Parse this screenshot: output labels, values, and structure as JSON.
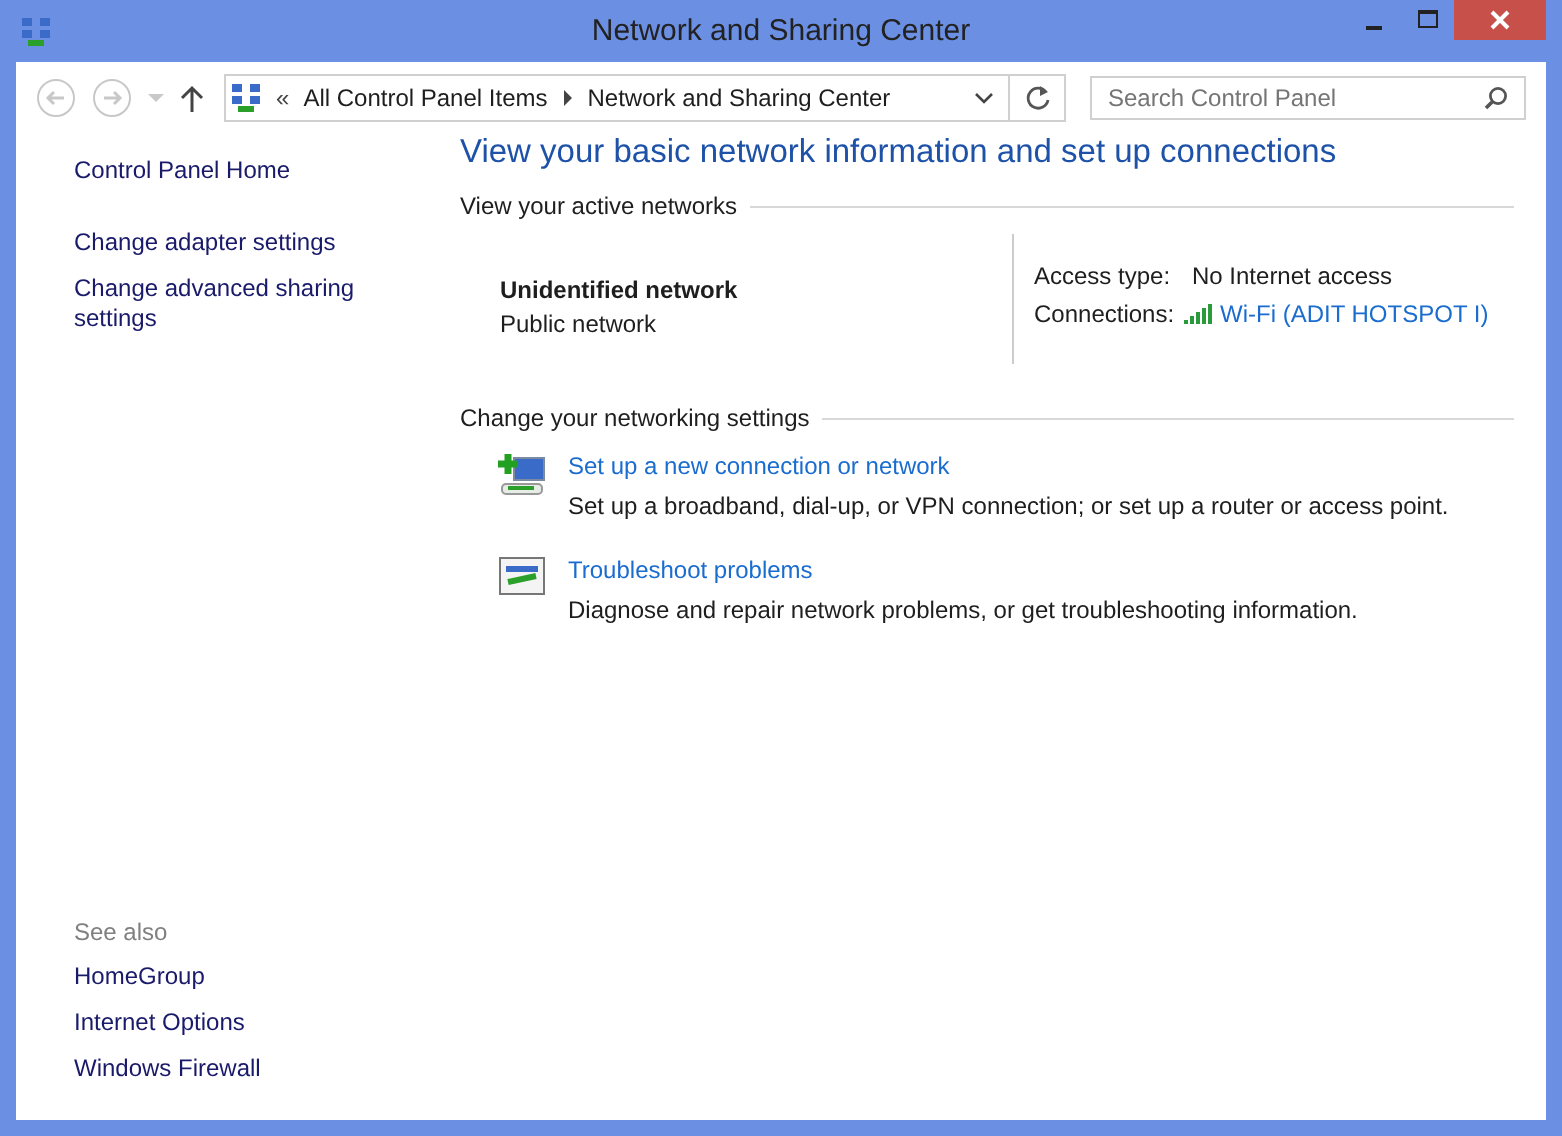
{
  "window": {
    "title": "Network and Sharing Center"
  },
  "address_bar": {
    "overflow": "«",
    "breadcrumbs": [
      "All Control Panel Items",
      "Network and Sharing Center"
    ]
  },
  "search": {
    "placeholder": "Search Control Panel"
  },
  "sidebar": {
    "items": [
      "Control Panel Home",
      "Change adapter settings",
      "Change advanced sharing settings"
    ],
    "see_also": {
      "heading": "See also",
      "items": [
        "HomeGroup",
        "Internet Options",
        "Windows Firewall"
      ]
    }
  },
  "main": {
    "heading": "View your basic network information and set up connections",
    "active_networks": {
      "heading": "View your active networks",
      "network_name": "Unidentified network",
      "network_type": "Public network",
      "access_type_label": "Access type:",
      "access_type": "No Internet access",
      "connections_label": "Connections:",
      "connection": "Wi-Fi (ADIT HOTSPOT I)"
    },
    "settings": {
      "heading": "Change your networking settings",
      "tasks": [
        {
          "kind": "new-connection",
          "link": "Set up a new connection or network",
          "description": "Set up a broadband, dial-up, or VPN connection; or set up a router or access point."
        },
        {
          "kind": "troubleshoot",
          "link": "Troubleshoot problems",
          "description": "Diagnose and repair network problems, or get troubleshooting information."
        }
      ]
    }
  }
}
